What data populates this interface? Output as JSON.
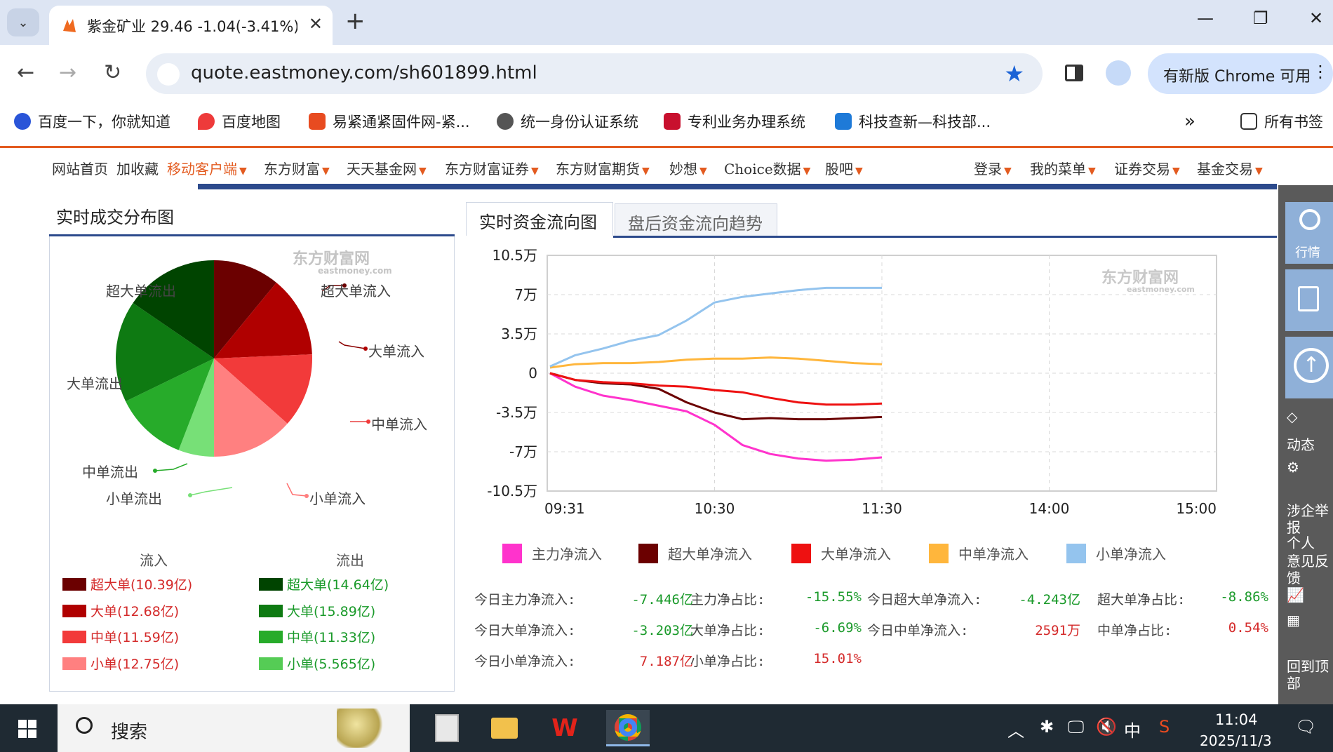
{
  "browser": {
    "tab_title": "紫金矿业 29.46 -1.04(-3.41%)",
    "url": "quote.eastmoney.com/sh601899.html",
    "update_label": "有新版 Chrome 可用",
    "bookmarks": [
      "百度一下，你就知道",
      "百度地图",
      "易紧通紧固件网-紧...",
      "统一身份认证系统",
      "专利业务办理系统",
      "科技查新—科技部..."
    ],
    "all_bookmarks": "所有书签",
    "more": "»"
  },
  "site_nav": {
    "left": [
      "网站首页",
      "加收藏",
      "移动客户端",
      "东方财富",
      "天天基金网",
      "东方财富证券",
      "东方财富期货",
      "妙想",
      "Choice数据",
      "股吧"
    ],
    "right": [
      "登录",
      "我的菜单",
      "证券交易",
      "基金交易"
    ]
  },
  "left_panel": {
    "title": "实时成交分布图",
    "watermark_cn": "东方财富网",
    "watermark_en": "eastmoney.com",
    "pie_labels": {
      "sl_in": "超大单流入",
      "l_in": "大单流入",
      "m_in": "中单流入",
      "s_in": "小单流入",
      "sl_out": "超大单流出",
      "l_out": "大单流出",
      "m_out": "中单流出",
      "s_out": "小单流出"
    },
    "inflow_header": "流入",
    "outflow_header": "流出",
    "inflow": [
      {
        "label": "超大单(10.39亿)",
        "color": "#6b0000"
      },
      {
        "label": "大单(12.68亿)",
        "color": "#b00000"
      },
      {
        "label": "中单(11.59亿)",
        "color": "#f23a3a"
      },
      {
        "label": "小单(12.75亿)",
        "color": "#ff8080"
      }
    ],
    "outflow": [
      {
        "label": "超大单(14.64亿)",
        "color": "#004400"
      },
      {
        "label": "大单(15.89亿)",
        "color": "#0e7a12"
      },
      {
        "label": "中单(11.33亿)",
        "color": "#27ab2a"
      },
      {
        "label": "小单(5.565亿)",
        "color": "#55cc55"
      }
    ]
  },
  "right_panel": {
    "tab_active": "实时资金流向图",
    "tab_inactive": "盘后资金流向趋势",
    "legend": [
      {
        "label": "主力净流入",
        "color": "#ff33cc"
      },
      {
        "label": "超大单净流入",
        "color": "#6b0000"
      },
      {
        "label": "大单净流入",
        "color": "#ee1111"
      },
      {
        "label": "中单净流入",
        "color": "#ffb63c"
      },
      {
        "label": "小单净流入",
        "color": "#94c4ee"
      }
    ],
    "stats": [
      {
        "label": "今日主力净流入:",
        "value": "-7.446亿",
        "sign": "neg"
      },
      {
        "label": "主力净占比:",
        "value": "-15.55%",
        "sign": "neg"
      },
      {
        "label": "今日超大单净流入:",
        "value": "-4.243亿",
        "sign": "neg"
      },
      {
        "label": "超大单净占比:",
        "value": "-8.86%",
        "sign": "neg"
      },
      {
        "label": "今日大单净流入:",
        "value": "-3.203亿",
        "sign": "neg"
      },
      {
        "label": "大单净占比:",
        "value": "-6.69%",
        "sign": "neg"
      },
      {
        "label": "今日中单净流入:",
        "value": "2591万",
        "sign": "pos"
      },
      {
        "label": "中单净占比:",
        "value": "0.54%",
        "sign": "pos"
      },
      {
        "label": "今日小单净流入:",
        "value": "7.187亿",
        "sign": "pos"
      },
      {
        "label": "小单净占比:",
        "value": "15.01%",
        "sign": "pos"
      }
    ]
  },
  "chart_data": [
    {
      "type": "pie",
      "title": "实时成交分布图",
      "categories": [
        "超大单流入",
        "大单流入",
        "中单流入",
        "小单流入",
        "小单流出",
        "中单流出",
        "大单流出",
        "超大单流出"
      ],
      "values": [
        10.39,
        12.68,
        11.59,
        12.75,
        5.565,
        11.33,
        15.89,
        14.64
      ],
      "colors": [
        "#6b0000",
        "#b00000",
        "#f23a3a",
        "#ff8080",
        "#77e077",
        "#27ab2a",
        "#0e7a12",
        "#004400"
      ],
      "unit": "亿"
    },
    {
      "type": "line",
      "title": "实时资金流向图",
      "x_ticks": [
        "09:31",
        "10:30",
        "11:30",
        "14:00",
        "15:00"
      ],
      "y_ticks": [
        "10.5万",
        "7万",
        "3.5万",
        "0",
        "-3.5万",
        "-7万",
        "-10.5万"
      ],
      "ylim": [
        -10.5,
        10.5
      ],
      "x_minutes_since_0930": [
        1,
        10,
        20,
        30,
        40,
        50,
        60,
        70,
        80,
        90,
        100,
        110,
        120
      ],
      "series": [
        {
          "name": "主力净流入",
          "color": "#ff33cc",
          "values": [
            0,
            -1.2,
            -2.0,
            -2.4,
            -2.9,
            -3.4,
            -4.6,
            -6.4,
            -7.2,
            -7.6,
            -7.8,
            -7.7,
            -7.5
          ]
        },
        {
          "name": "超大单净流入",
          "color": "#6b0000",
          "values": [
            0,
            -0.6,
            -0.9,
            -1.0,
            -1.4,
            -2.6,
            -3.5,
            -4.1,
            -4.0,
            -4.1,
            -4.1,
            -4.0,
            -3.9
          ]
        },
        {
          "name": "大单净流入",
          "color": "#ee1111",
          "values": [
            0,
            -0.6,
            -0.8,
            -0.9,
            -1.1,
            -1.2,
            -1.5,
            -1.7,
            -2.2,
            -2.6,
            -2.8,
            -2.8,
            -2.7
          ]
        },
        {
          "name": "中单净流入",
          "color": "#ffb63c",
          "values": [
            0.5,
            0.8,
            0.9,
            0.9,
            1.0,
            1.2,
            1.3,
            1.3,
            1.4,
            1.3,
            1.1,
            0.9,
            0.8
          ]
        },
        {
          "name": "小单净流入",
          "color": "#94c4ee",
          "values": [
            0.6,
            1.6,
            2.2,
            2.9,
            3.4,
            4.7,
            6.3,
            6.8,
            7.1,
            7.4,
            7.6,
            7.6,
            7.6
          ]
        }
      ]
    }
  ],
  "float_bar": {
    "items": [
      "行情",
      "动态",
      "意见反馈",
      "回到顶部"
    ],
    "report": "涉企举报",
    "personal": "个人"
  },
  "taskbar": {
    "search_label": "搜索",
    "time": "11:04",
    "date": "2025/11/3",
    "ime": "中"
  }
}
